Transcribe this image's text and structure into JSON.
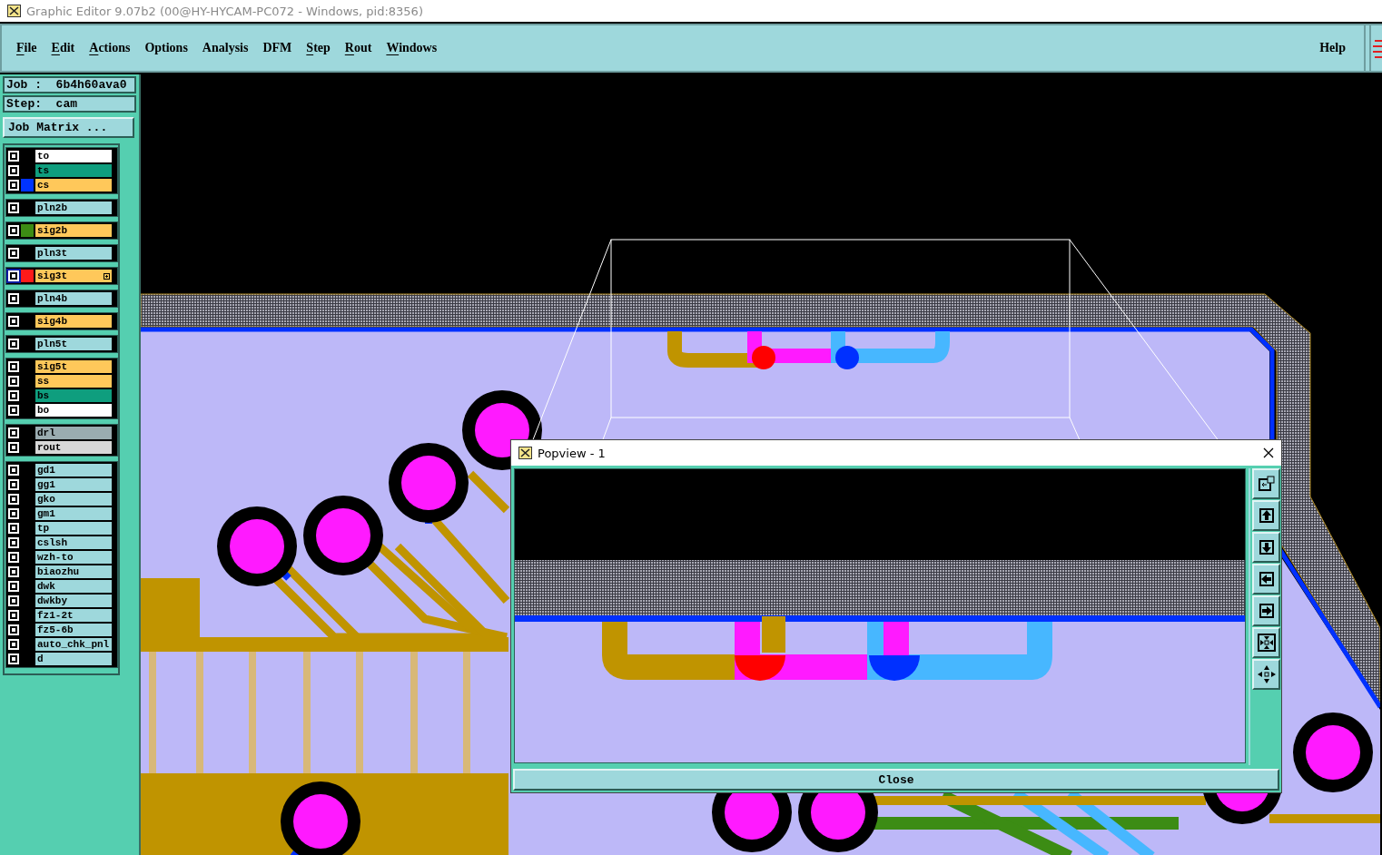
{
  "window": {
    "title": "Graphic Editor 9.07b2 (00@HY-HYCAM-PC072 - Windows, pid:8356)"
  },
  "menu": [
    {
      "label": "File",
      "mnemonic": true
    },
    {
      "label": "Edit",
      "mnemonic": true
    },
    {
      "label": "Actions",
      "mnemonic": true
    },
    {
      "label": "Options",
      "mnemonic": false
    },
    {
      "label": "Analysis",
      "mnemonic": false
    },
    {
      "label": "DFM",
      "mnemonic": false
    },
    {
      "label": "Step",
      "mnemonic": true
    },
    {
      "label": "Rout",
      "mnemonic": true
    },
    {
      "label": "Windows",
      "mnemonic": true
    }
  ],
  "help": {
    "label": "Help"
  },
  "job": {
    "job_line": "Job :  6b4h60ava0",
    "step_line": "Step:  cam",
    "matrix_button": "Job Matrix ..."
  },
  "layer_groups": [
    {
      "layers": [
        {
          "name": "to",
          "color": "#ffffff",
          "selected": false
        },
        {
          "name": "ts",
          "color": "#0f9e7e",
          "selected": false
        },
        {
          "name": "cs",
          "color": "#ffc85a",
          "swatch": {
            "color": "#0033ff"
          },
          "selected": false
        }
      ]
    },
    {
      "layers": [
        {
          "name": "pln2b",
          "color": "#9ed8dc",
          "selected": false
        }
      ]
    },
    {
      "layers": [
        {
          "name": "sig2b",
          "color": "#ffc85a",
          "swatch": {
            "color": "#3c8c14"
          },
          "selected": false
        }
      ]
    },
    {
      "layers": [
        {
          "name": "pln3t",
          "color": "#9ed8dc",
          "selected": false
        }
      ]
    },
    {
      "layers": [
        {
          "name": "sig3t",
          "color": "#ffc85a",
          "swatch": {
            "color": "#ff1a1a"
          },
          "selected": true
        }
      ]
    },
    {
      "layers": [
        {
          "name": "pln4b",
          "color": "#9ed8dc",
          "selected": false
        }
      ]
    },
    {
      "layers": [
        {
          "name": "sig4b",
          "color": "#ffc85a",
          "selected": false
        }
      ]
    },
    {
      "layers": [
        {
          "name": "pln5t",
          "color": "#9ed8dc",
          "selected": false
        }
      ]
    },
    {
      "layers": [
        {
          "name": "sig5t",
          "color": "#ffc85a",
          "selected": false
        },
        {
          "name": "ss",
          "color": "#ffc85a",
          "selected": false
        },
        {
          "name": "bs",
          "color": "#0f9e7e",
          "selected": false
        },
        {
          "name": "bo",
          "color": "#ffffff",
          "selected": false
        }
      ]
    },
    {
      "layers": [
        {
          "name": "drl",
          "color": "#9aacb0",
          "selected": false
        },
        {
          "name": "rout",
          "color": "#d8d8d8",
          "selected": false
        }
      ]
    },
    {
      "layers": [
        {
          "name": "gd1",
          "color": "#9ed8dc",
          "selected": false
        },
        {
          "name": "gg1",
          "color": "#9ed8dc",
          "selected": false
        },
        {
          "name": "gko",
          "color": "#9ed8dc",
          "selected": false
        },
        {
          "name": "gm1",
          "color": "#9ed8dc",
          "selected": false
        },
        {
          "name": "tp",
          "color": "#9ed8dc",
          "selected": false
        },
        {
          "name": "cslsh",
          "color": "#9ed8dc",
          "selected": false
        },
        {
          "name": "wzh-to",
          "color": "#9ed8dc",
          "selected": false
        },
        {
          "name": "biaozhu",
          "color": "#9ed8dc",
          "selected": false
        },
        {
          "name": "dwk",
          "color": "#9ed8dc",
          "selected": false
        },
        {
          "name": "dwkby",
          "color": "#9ed8dc",
          "selected": false
        },
        {
          "name": "fz1-2t",
          "color": "#9ed8dc",
          "selected": false
        },
        {
          "name": "fz5-6b",
          "color": "#9ed8dc",
          "selected": false
        },
        {
          "name": "auto_chk_pnl",
          "color": "#9ed8dc",
          "selected": false
        },
        {
          "name": "d",
          "color": "#9ed8dc",
          "selected": false
        }
      ]
    }
  ],
  "popview": {
    "title": "Popview - 1",
    "close_button": "Close",
    "tool_buttons": [
      {
        "kind": "window"
      },
      {
        "kind": "up"
      },
      {
        "kind": "down"
      },
      {
        "kind": "left"
      },
      {
        "kind": "right"
      },
      {
        "kind": "zoom_in"
      },
      {
        "kind": "zoom_out"
      }
    ]
  }
}
